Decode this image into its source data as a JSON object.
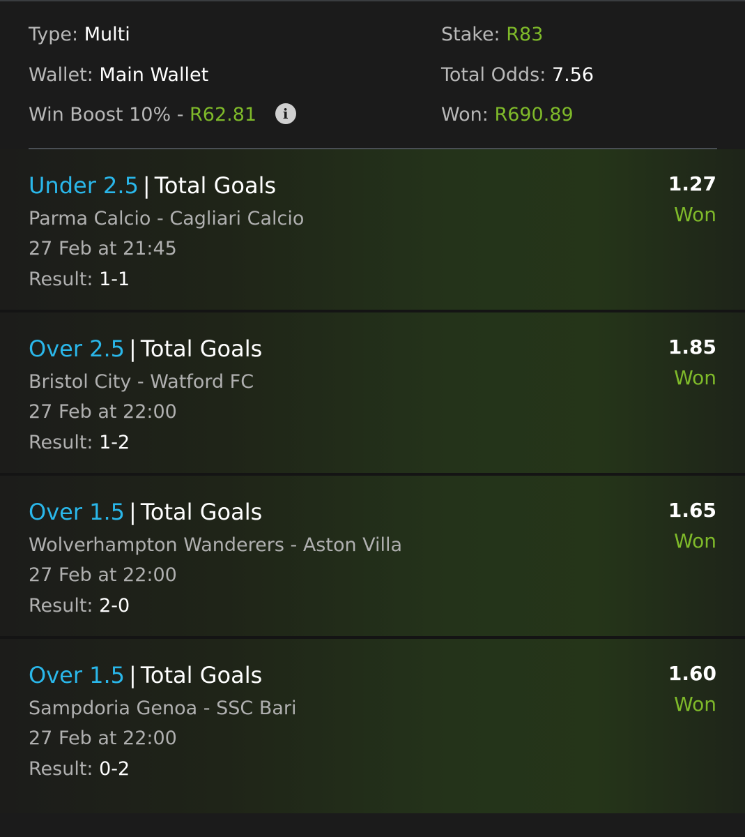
{
  "summary": {
    "type_label": "Type:",
    "type_value": "Multi",
    "wallet_label": "Wallet:",
    "wallet_value": "Main Wallet",
    "boost_label": "Win Boost 10% -",
    "boost_value": "R62.81",
    "info_icon": "i",
    "stake_label": "Stake:",
    "stake_value": "R83",
    "odds_label": "Total Odds:",
    "odds_value": "7.56",
    "won_label": "Won:",
    "won_value": "R690.89"
  },
  "colors": {
    "accent_blue": "#2ab7ea",
    "won_green": "#7fba2a",
    "background": "#1b1b1b"
  },
  "selections": [
    {
      "pick": "Under 2.5",
      "separator": "|",
      "market": "Total Goals",
      "match": "Parma Calcio - Cagliari Calcio",
      "datetime": "27 Feb at 21:45",
      "result_label": "Result:",
      "result_value": "1-1",
      "odds": "1.27",
      "status": "Won"
    },
    {
      "pick": "Over 2.5",
      "separator": "|",
      "market": "Total Goals",
      "match": "Bristol City - Watford FC",
      "datetime": "27 Feb at 22:00",
      "result_label": "Result:",
      "result_value": "1-2",
      "odds": "1.85",
      "status": "Won"
    },
    {
      "pick": "Over 1.5",
      "separator": "|",
      "market": "Total Goals",
      "match": "Wolverhampton Wanderers - Aston Villa",
      "datetime": "27 Feb at 22:00",
      "result_label": "Result:",
      "result_value": "2-0",
      "odds": "1.65",
      "status": "Won"
    },
    {
      "pick": "Over 1.5",
      "separator": "|",
      "market": "Total Goals",
      "match": "Sampdoria Genoa - SSC Bari",
      "datetime": "27 Feb at 22:00",
      "result_label": "Result:",
      "result_value": "0-2",
      "odds": "1.60",
      "status": "Won"
    }
  ]
}
